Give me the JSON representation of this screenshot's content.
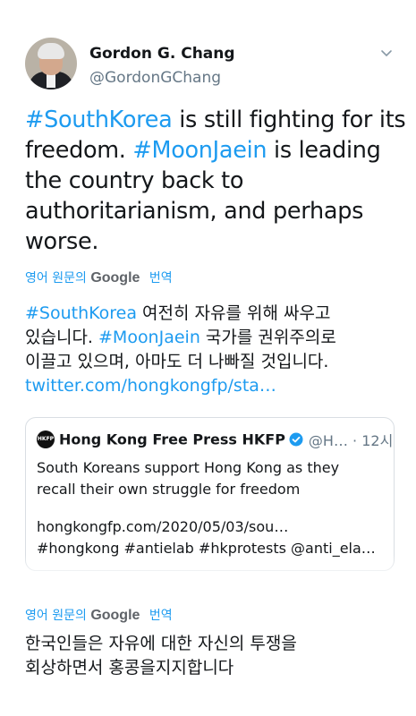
{
  "author": {
    "name": "Gordon G. Chang",
    "handle": "@GordonGChang"
  },
  "tweet": {
    "lines": [
      [
        {
          "t": "#SouthKorea",
          "h": true
        },
        {
          "t": " is still fighting for its",
          "h": false
        }
      ],
      [
        {
          "t": "freedom. ",
          "h": false
        },
        {
          "t": "#MoonJaein",
          "h": true
        },
        {
          "t": " is leading",
          "h": false
        }
      ],
      [
        {
          "t": "the country back to",
          "h": false
        }
      ],
      [
        {
          "t": "authoritarianism, and perhaps",
          "h": false
        }
      ],
      [
        {
          "t": "worse.",
          "h": false
        }
      ]
    ]
  },
  "translation_bar": {
    "prefix": "영어 원문의",
    "google": "Google",
    "suffix": "번역"
  },
  "translated": {
    "lines": [
      [
        {
          "t": "#SouthKorea",
          "h": true
        },
        {
          "t": " 여전히 자유를 위해 싸우고",
          "h": false
        }
      ],
      [
        {
          "t": "있습니다. ",
          "h": false
        },
        {
          "t": "#MoonJaein",
          "h": true
        },
        {
          "t": " 국가를 권위주의로",
          "h": false
        }
      ],
      [
        {
          "t": "이끌고 있으며, 아마도 더 나빠질 것입니다.",
          "h": false
        }
      ],
      [
        {
          "t": "twitter.com/hongkongfp/sta…",
          "h": true
        }
      ]
    ]
  },
  "quoted": {
    "logo_text": "HKFP",
    "name": "Hong Kong Free Press HKFP",
    "handle": "@H…",
    "dot": "·",
    "time": "12시",
    "text_line1": "South Koreans support Hong Kong as they",
    "text_line2": "recall their own struggle for freedom",
    "link_line": "hongkongfp.com/2020/05/03/sou…",
    "tags_line": "#hongkong #antielab #hkprotests @anti_ela…"
  },
  "quoted_translation": {
    "line1": "한국인들은 자유에 대한 자신의 투쟁을",
    "line2": "회상하면서 홍콩을지지합니다"
  },
  "colors": {
    "accent": "#1d9bf0",
    "secondary_text": "#657786",
    "border": "#d9dee3"
  }
}
